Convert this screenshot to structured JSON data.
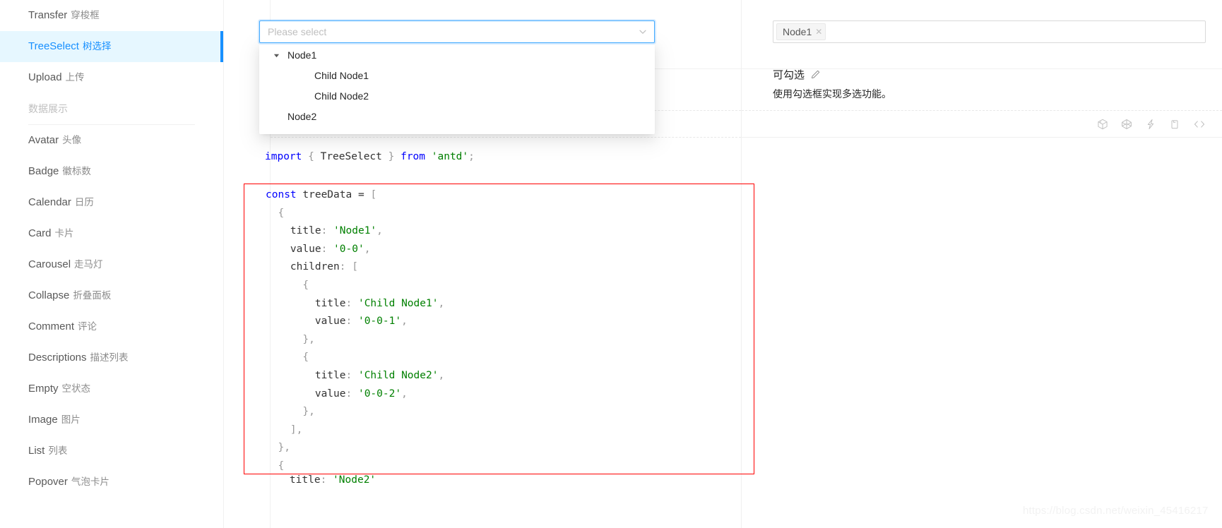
{
  "sidebar": {
    "items": [
      {
        "type": "item",
        "en": "Transfer",
        "cn": "穿梭框",
        "selected": false
      },
      {
        "type": "item",
        "en": "TreeSelect",
        "cn": "树选择",
        "selected": true
      },
      {
        "type": "item",
        "en": "Upload",
        "cn": "上传",
        "selected": false
      },
      {
        "type": "group",
        "en": "",
        "cn": "数据展示",
        "selected": false
      },
      {
        "type": "item",
        "en": "Avatar",
        "cn": "头像",
        "selected": false
      },
      {
        "type": "item",
        "en": "Badge",
        "cn": "徽标数",
        "selected": false
      },
      {
        "type": "item",
        "en": "Calendar",
        "cn": "日历",
        "selected": false
      },
      {
        "type": "item",
        "en": "Card",
        "cn": "卡片",
        "selected": false
      },
      {
        "type": "item",
        "en": "Carousel",
        "cn": "走马灯",
        "selected": false
      },
      {
        "type": "item",
        "en": "Collapse",
        "cn": "折叠面板",
        "selected": false
      },
      {
        "type": "item",
        "en": "Comment",
        "cn": "评论",
        "selected": false
      },
      {
        "type": "item",
        "en": "Descriptions",
        "cn": "描述列表",
        "selected": false
      },
      {
        "type": "item",
        "en": "Empty",
        "cn": "空状态",
        "selected": false
      },
      {
        "type": "item",
        "en": "Image",
        "cn": "图片",
        "selected": false
      },
      {
        "type": "item",
        "en": "List",
        "cn": "列表",
        "selected": false
      },
      {
        "type": "item",
        "en": "Popover",
        "cn": "气泡卡片",
        "selected": false
      }
    ]
  },
  "select": {
    "placeholder": "Please select",
    "value": "",
    "arrow_icon": "chevron-down-icon"
  },
  "dropdown": {
    "nodes": [
      {
        "label": "Node1",
        "level": 0,
        "expanded": true
      },
      {
        "label": "Child Node1",
        "level": 1,
        "expanded": false
      },
      {
        "label": "Child Node2",
        "level": 1,
        "expanded": false
      },
      {
        "label": "Node2",
        "level": 0,
        "expanded": false
      }
    ]
  },
  "right_panel": {
    "tag_label": "Node1",
    "tag_close_icon": "close-icon",
    "section_title": "可勾选",
    "edit_icon": "edit-pencil-icon",
    "section_description": "使用勾选框实现多选功能。",
    "actions": [
      {
        "name": "codesandbox-icon",
        "title": "codesandbox"
      },
      {
        "name": "codepen-icon",
        "title": "codepen"
      },
      {
        "name": "thunderbolt-icon",
        "title": "thunderbolt"
      },
      {
        "name": "snippets-icon",
        "title": "snippets"
      },
      {
        "name": "code-brackets-icon",
        "title": "code"
      }
    ]
  },
  "code": {
    "import_tokens": [
      {
        "t": "import",
        "c": "kw"
      },
      {
        "t": " ",
        "c": "plain"
      },
      {
        "t": "{",
        "c": "pun"
      },
      {
        "t": " TreeSelect ",
        "c": "plain"
      },
      {
        "t": "}",
        "c": "pun"
      },
      {
        "t": " ",
        "c": "plain"
      },
      {
        "t": "from",
        "c": "kw"
      },
      {
        "t": " ",
        "c": "plain"
      },
      {
        "t": "'antd'",
        "c": "str"
      },
      {
        "t": ";",
        "c": "pun"
      }
    ],
    "block_lines": [
      [
        {
          "t": "const",
          "c": "kw"
        },
        {
          "t": " treeData ",
          "c": "plain"
        },
        {
          "t": "=",
          "c": "op"
        },
        {
          "t": " ",
          "c": "plain"
        },
        {
          "t": "[",
          "c": "pun"
        }
      ],
      [
        {
          "t": "  ",
          "c": "plain"
        },
        {
          "t": "{",
          "c": "pun"
        }
      ],
      [
        {
          "t": "    title",
          "c": "plain"
        },
        {
          "t": ":",
          "c": "pun"
        },
        {
          "t": " ",
          "c": "plain"
        },
        {
          "t": "'Node1'",
          "c": "str"
        },
        {
          "t": ",",
          "c": "pun"
        }
      ],
      [
        {
          "t": "    value",
          "c": "plain"
        },
        {
          "t": ":",
          "c": "pun"
        },
        {
          "t": " ",
          "c": "plain"
        },
        {
          "t": "'0-0'",
          "c": "str"
        },
        {
          "t": ",",
          "c": "pun"
        }
      ],
      [
        {
          "t": "    children",
          "c": "plain"
        },
        {
          "t": ":",
          "c": "pun"
        },
        {
          "t": " ",
          "c": "plain"
        },
        {
          "t": "[",
          "c": "pun"
        }
      ],
      [
        {
          "t": "      ",
          "c": "plain"
        },
        {
          "t": "{",
          "c": "pun"
        }
      ],
      [
        {
          "t": "        title",
          "c": "plain"
        },
        {
          "t": ":",
          "c": "pun"
        },
        {
          "t": " ",
          "c": "plain"
        },
        {
          "t": "'Child Node1'",
          "c": "str"
        },
        {
          "t": ",",
          "c": "pun"
        }
      ],
      [
        {
          "t": "        value",
          "c": "plain"
        },
        {
          "t": ":",
          "c": "pun"
        },
        {
          "t": " ",
          "c": "plain"
        },
        {
          "t": "'0-0-1'",
          "c": "str"
        },
        {
          "t": ",",
          "c": "pun"
        }
      ],
      [
        {
          "t": "      ",
          "c": "plain"
        },
        {
          "t": "},",
          "c": "pun"
        }
      ],
      [
        {
          "t": "      ",
          "c": "plain"
        },
        {
          "t": "{",
          "c": "pun"
        }
      ],
      [
        {
          "t": "        title",
          "c": "plain"
        },
        {
          "t": ":",
          "c": "pun"
        },
        {
          "t": " ",
          "c": "plain"
        },
        {
          "t": "'Child Node2'",
          "c": "str"
        },
        {
          "t": ",",
          "c": "pun"
        }
      ],
      [
        {
          "t": "        value",
          "c": "plain"
        },
        {
          "t": ":",
          "c": "pun"
        },
        {
          "t": " ",
          "c": "plain"
        },
        {
          "t": "'0-0-2'",
          "c": "str"
        },
        {
          "t": ",",
          "c": "pun"
        }
      ],
      [
        {
          "t": "      ",
          "c": "plain"
        },
        {
          "t": "},",
          "c": "pun"
        }
      ],
      [
        {
          "t": "    ",
          "c": "plain"
        },
        {
          "t": "],",
          "c": "pun"
        }
      ],
      [
        {
          "t": "  ",
          "c": "plain"
        },
        {
          "t": "},",
          "c": "pun"
        }
      ],
      [
        {
          "t": "  ",
          "c": "plain"
        },
        {
          "t": "{",
          "c": "pun"
        }
      ]
    ],
    "tail_line": [
      {
        "t": "    title",
        "c": "plain"
      },
      {
        "t": ":",
        "c": "pun"
      },
      {
        "t": " ",
        "c": "plain"
      },
      {
        "t": "'Node2'",
        "c": "str"
      }
    ]
  },
  "watermark": {
    "text": "https://blog.csdn.net/weixin_45416217"
  }
}
